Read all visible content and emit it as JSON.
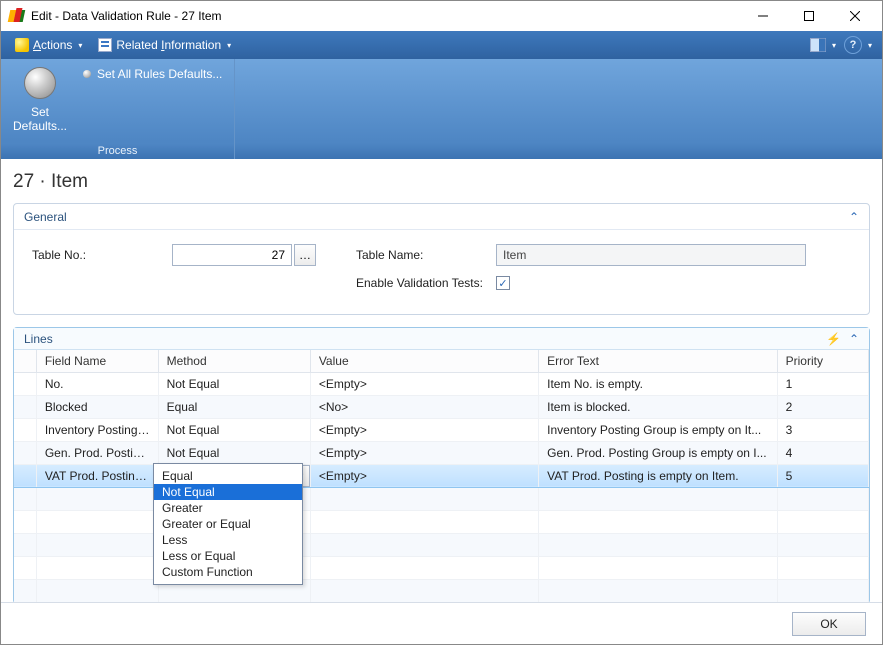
{
  "window": {
    "title": "Edit - Data Validation Rule - 27 Item"
  },
  "menubar": {
    "actions_prefix": "A",
    "actions_rest": "ctions",
    "related_prefix": "Related ",
    "related_underline": "I",
    "related_rest": "nformation"
  },
  "ribbon": {
    "set_defaults_line1": "Set",
    "set_defaults_line2": "Defaults...",
    "set_all_rules": "Set All Rules Defaults...",
    "group_label": "Process"
  },
  "page": {
    "title": "27 · Item"
  },
  "general": {
    "header": "General",
    "table_no_label": "Table No.:",
    "table_no_value": "27",
    "table_name_label": "Table Name:",
    "table_name_value": "Item",
    "enable_label": "Enable Validation Tests:",
    "enable_checked": true
  },
  "lines": {
    "header": "Lines",
    "columns": {
      "field": "Field Name",
      "method": "Method",
      "value": "Value",
      "error": "Error Text",
      "priority": "Priority"
    },
    "rows": [
      {
        "field": "No.",
        "method": "Not Equal",
        "value": "<Empty>",
        "error": "Item No. is empty.",
        "priority": "1"
      },
      {
        "field": "Blocked",
        "method": "Equal",
        "value": "<No>",
        "error": "Item is blocked.",
        "priority": "2"
      },
      {
        "field": "Inventory Posting ...",
        "method": "Not Equal",
        "value": "<Empty>",
        "error": "Inventory Posting Group is empty on It...",
        "priority": "3"
      },
      {
        "field": "Gen. Prod. Posting ...",
        "method": "Not Equal",
        "value": "<Empty>",
        "error": "Gen. Prod. Posting Group is empty on I...",
        "priority": "4"
      },
      {
        "field": "VAT Prod. Posting ...",
        "method": "Not Equal",
        "value": "<Empty>",
        "error": "VAT Prod. Posting is empty on Item.",
        "priority": "5",
        "active": true
      }
    ],
    "empty_rows": 5,
    "dropdown": {
      "options": [
        "Equal",
        "Not Equal",
        "Greater",
        "Greater or Equal",
        "Less",
        "Less or Equal",
        "Custom Function"
      ],
      "selected": "Not Equal"
    }
  },
  "footer": {
    "ok": "OK"
  }
}
